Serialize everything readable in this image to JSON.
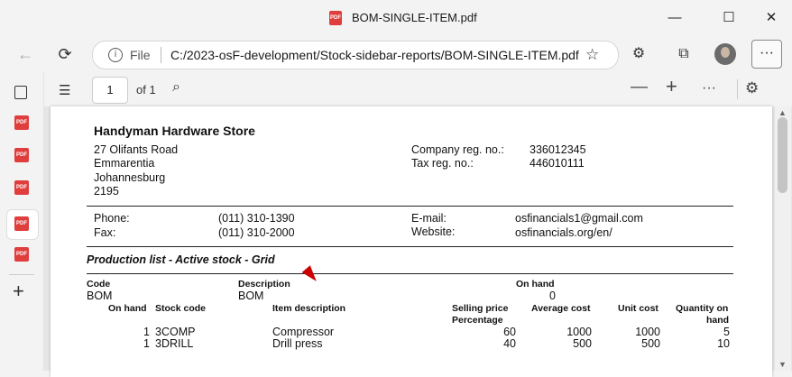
{
  "window": {
    "title": "BOM-SINGLE-ITEM.pdf",
    "minimize": "—",
    "maximize": "☐",
    "close": "✕"
  },
  "browser": {
    "back": "←",
    "reload": "⟳",
    "file_label": "File",
    "url": "C:/2023-osF-development/Stock-sidebar-reports/BOM-SINGLE-ITEM.pdf",
    "more": "···",
    "info": "i"
  },
  "pdf_toolbar": {
    "page_value": "1",
    "page_of": "of 1",
    "zoom_out": "—",
    "zoom_in": "+",
    "more": "···"
  },
  "sidebar": {
    "pdf_label": "PDF",
    "add": "+"
  },
  "document": {
    "company": "Handyman Hardware Store",
    "address": [
      "27 Olifants Road",
      "Emmarentia",
      "Johannesburg",
      "2195"
    ],
    "reg_labels": [
      "Company reg. no.:",
      "Tax reg. no.:"
    ],
    "reg_values": [
      "336012345",
      "446010111"
    ],
    "phone_label": "Phone:",
    "phone": "(011) 310-1390",
    "fax_label": "Fax:",
    "fax": "(011) 310-2000",
    "email_label": "E-mail:",
    "email": "osfinancials1@gmail.com",
    "website_label": "Website:",
    "website": "osfinancials.org/en/",
    "report_title": "Production list - Active stock - Grid",
    "header_labels": {
      "code": "Code",
      "description": "Description",
      "on_hand": "On hand"
    },
    "bom_row": {
      "code": "BOM",
      "description": "BOM",
      "on_hand": "0"
    },
    "columns": {
      "on_hand": "On hand",
      "stock_code": "Stock code",
      "item_description": "Item description",
      "selling_price": "Selling price",
      "percentage": "Percentage",
      "average_cost": "Average cost",
      "unit_cost": "Unit cost",
      "qty_on": "Quantity on",
      "qty_hand": "hand"
    },
    "rows": [
      {
        "on_hand": "1",
        "stock_code": "3COMP",
        "description": "Compressor",
        "selling_price": "60",
        "average_cost": "1000",
        "unit_cost": "1000",
        "quantity": "5"
      },
      {
        "on_hand": "1",
        "stock_code": "3DRILL",
        "description": "Drill press",
        "selling_price": "40",
        "average_cost": "500",
        "unit_cost": "500",
        "quantity": "10"
      }
    ]
  }
}
